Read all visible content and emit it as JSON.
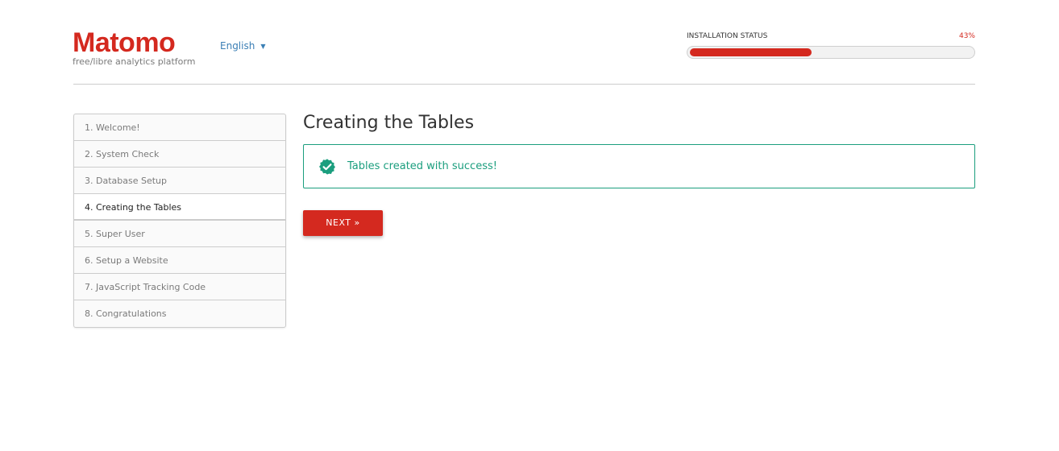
{
  "header": {
    "logo_text": "Matomo",
    "tagline": "free/libre analytics platform",
    "language": "English",
    "status_label": "INSTALLATION STATUS",
    "status_percent_label": "43%",
    "status_progress": 0.43
  },
  "steps": [
    {
      "label": "1. Welcome!"
    },
    {
      "label": "2. System Check"
    },
    {
      "label": "3. Database Setup"
    },
    {
      "label": "4. Creating the Tables"
    },
    {
      "label": "5. Super User"
    },
    {
      "label": "6. Setup a Website"
    },
    {
      "label": "7. JavaScript Tracking Code"
    },
    {
      "label": "8. Congratulations"
    }
  ],
  "current_step": 4,
  "main": {
    "title": "Creating the Tables",
    "success_message": "Tables created with success!",
    "success_icon": "check-badge-icon",
    "next_label": "NEXT »"
  },
  "colors": {
    "brand": "#d4291f",
    "success": "#1b9e7e",
    "link": "#3b7fb5"
  }
}
